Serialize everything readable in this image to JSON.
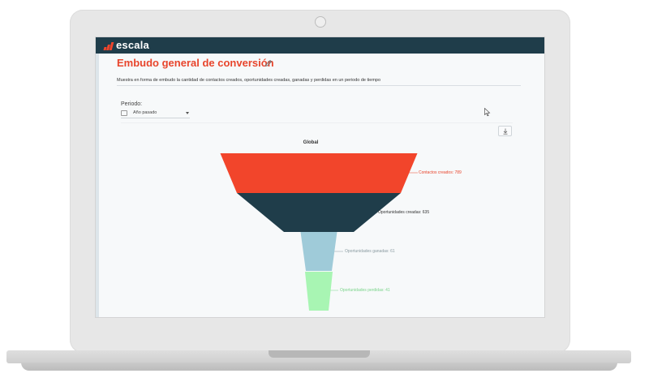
{
  "app": {
    "brand": "escala",
    "colors": {
      "topbar": "#1f3d4a",
      "accent": "#e8452c"
    }
  },
  "page": {
    "title": "Embudo general de conversión",
    "description": "Muestra en forma de embudo la cantidad de contactos creados, oportunidades creadas, ganadas y perdidas en un periodo de tiempo",
    "icons": [
      "edit-icon",
      "calendar-icon",
      "download-icon",
      "cursor-icon"
    ]
  },
  "filters": {
    "period_label": "Periodo:",
    "period_value": "Año pasado"
  },
  "chart_data": {
    "type": "funnel",
    "title": "Global",
    "stages": [
      {
        "label": "Contactos creados: 789",
        "name": "Contactos creados",
        "value": 789,
        "color": "#f2452b"
      },
      {
        "label": "Oportunidades creadas: 635",
        "name": "Oportunidades creadas",
        "value": 635,
        "color": "#1f3d4a"
      },
      {
        "label": "Oportunidades ganadas: 61",
        "name": "Oportunidades ganadas",
        "value": 61,
        "color": "#9fcbd9"
      },
      {
        "label": "Oportunidades perdidas: 41",
        "name": "Oportunidades perdidas",
        "value": 41,
        "color": "#a8f5b3"
      }
    ]
  }
}
